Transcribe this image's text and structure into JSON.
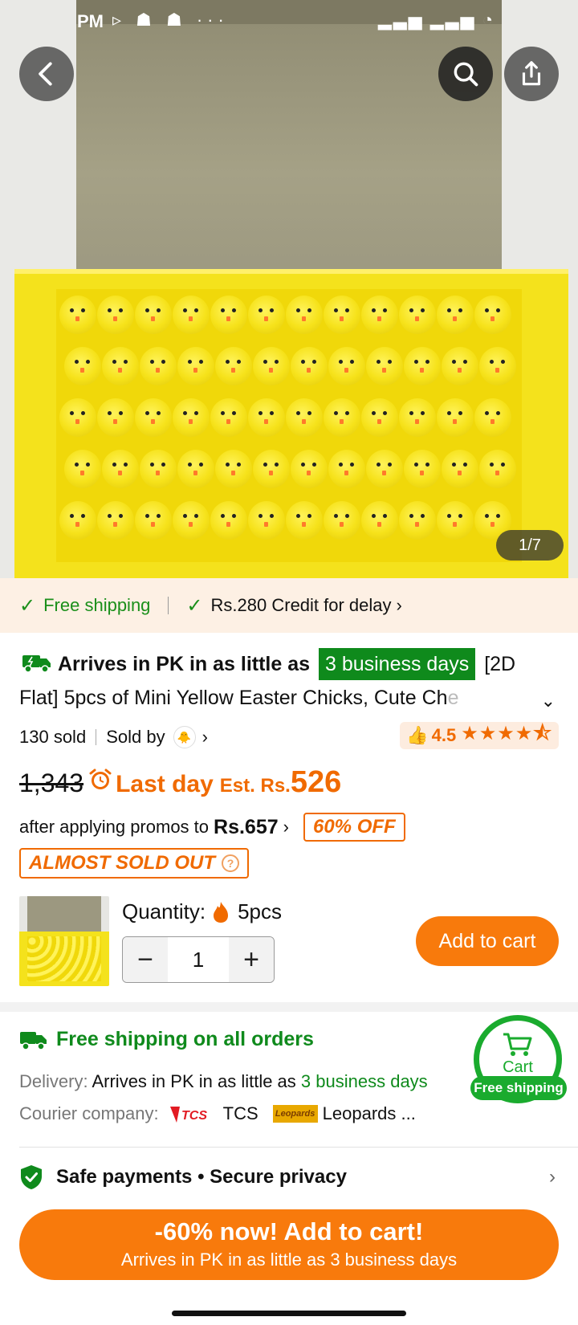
{
  "status_bar": {
    "time": "PM",
    "left_icons": "▹ ☗ ☗ ···",
    "right_icons": "▂▃▅ ▂▃▅ ◔"
  },
  "gallery": {
    "counter": "1/7"
  },
  "shipping_strip": {
    "free_shipping": "Free shipping",
    "credit": "Rs.280 Credit for delay"
  },
  "title": {
    "arrives_prefix": "Arrives in PK in as little as",
    "arrives_badge": "3 business days",
    "product_name": "[2D Flat] 5pcs of Mini Yellow Easter Chicks, Cute Ch",
    "product_fade": "e"
  },
  "sales": {
    "sold": "130 sold",
    "sold_by": "Sold by",
    "rating": "4.5",
    "stars": "★★★★⯪"
  },
  "price": {
    "old": "1,343",
    "last_day": "Last day",
    "est_label": "Est. Rs.",
    "est_value": "526",
    "promo_text": "after applying promos to",
    "promo_price": "Rs.657",
    "off_badge": "60% OFF",
    "almost_sold_out": "ALMOST SOLD OUT"
  },
  "quantity": {
    "label": "Quantity:",
    "variant": "5pcs",
    "value": "1",
    "add_to_cart": "Add to cart"
  },
  "delivery": {
    "free_all": "Free shipping on all orders",
    "delivery_label": "Delivery:",
    "delivery_text": "Arrives in PK in as little as",
    "delivery_days": "3 business days",
    "courier_label": "Courier company:",
    "courier_tcs": "TCS",
    "courier_leopards": "Leopards ...",
    "leopards_logo": "Leopards"
  },
  "cart_float": {
    "label": "Cart",
    "pill": "Free shipping"
  },
  "safe": {
    "label": "Safe payments • Secure privacy"
  },
  "cta": {
    "line1": "-60% now! Add to cart!",
    "line2": "Arrives in PK in as little as 3 business days"
  },
  "colors": {
    "accent_orange": "#f87a0c",
    "green": "#0f8a1c",
    "cart_green": "#1aab2e"
  }
}
